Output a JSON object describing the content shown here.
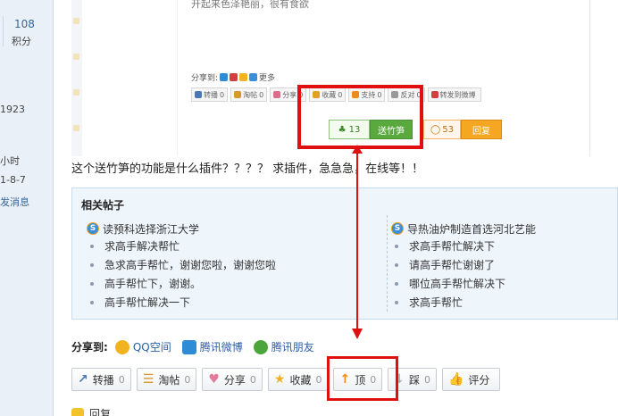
{
  "sidebar": {
    "stat_value": "108",
    "stat_label": "积分",
    "uid": "1923",
    "hours": "小时",
    "reg_date": "1-8-7",
    "send_message": "发消息"
  },
  "embed": {
    "snippet": "开起来色泽艳丽，很有食欲",
    "share_label": "分享到:",
    "share_more": "更多",
    "mini_buttons": [
      {
        "label": "转播",
        "count": "0",
        "color": "#4a78b5"
      },
      {
        "label": "淘帖",
        "count": "0",
        "color": "#d69a2a"
      },
      {
        "label": "分享",
        "count": "0",
        "color": "#e06a8a"
      },
      {
        "label": "收藏",
        "count": "0",
        "color": "#e0a020"
      },
      {
        "label": "支持",
        "count": "0",
        "color": "#f08a1c"
      },
      {
        "label": "反对",
        "count": "0",
        "color": "#999999"
      },
      {
        "label": "转发到微博",
        "count": "",
        "color": "#d04040"
      }
    ],
    "bamboo_count": "13",
    "bamboo_button": "送竹笋",
    "reply_count": "53",
    "reply_button": "回复"
  },
  "question": "这个送竹笋的功能是什么插件？？？？ 求插件，急急急，在线等！！",
  "related": {
    "title": "相关帖子",
    "left": {
      "head": "读预科选择浙江大学",
      "items": [
        "求高手解决帮忙",
        "急求高手帮忙，谢谢您啦，谢谢您啦",
        "高手帮忙下，谢谢。",
        "高手帮忙解决一下"
      ]
    },
    "right": {
      "head": "导热油炉制造首选河北艺能",
      "items": [
        "求高手帮忙解决下",
        "请高手帮忙谢谢了",
        "哪位高手帮忙解决下",
        "求高手帮忙"
      ]
    }
  },
  "share": {
    "label": "分享到:",
    "items": [
      {
        "label": "QQ空间",
        "icon": "qzone-icon",
        "color": "#f2b320"
      },
      {
        "label": "腾讯微博",
        "icon": "tencent-weibo-icon",
        "color": "#2e8bd6"
      },
      {
        "label": "腾讯朋友",
        "icon": "tencent-friends-icon",
        "color": "#4aa63a"
      }
    ]
  },
  "actions": [
    {
      "label": "转播",
      "count": "0",
      "icon": "repost-icon",
      "color": "#4a78b5"
    },
    {
      "label": "淘帖",
      "count": "0",
      "icon": "collect-icon",
      "color": "#d69a2a"
    },
    {
      "label": "分享",
      "count": "0",
      "icon": "heart-icon",
      "color": "#e67a9a"
    },
    {
      "label": "收藏",
      "count": "0",
      "icon": "star-icon",
      "color": "#f0b020"
    },
    {
      "label": "顶",
      "count": "0",
      "icon": "up-arrow-icon",
      "color": "#f08a1c"
    },
    {
      "label": "踩",
      "count": "0",
      "icon": "down-arrow-icon",
      "color": "#b0b0b0"
    },
    {
      "label": "评分",
      "count": "",
      "icon": "thumb-icon",
      "color": "#e09050"
    }
  ],
  "bottom": {
    "reply_label": "回复"
  },
  "colors": {
    "highlight": "#e01010",
    "link": "#2b5ea6",
    "related_bg": "#eef6fc"
  }
}
